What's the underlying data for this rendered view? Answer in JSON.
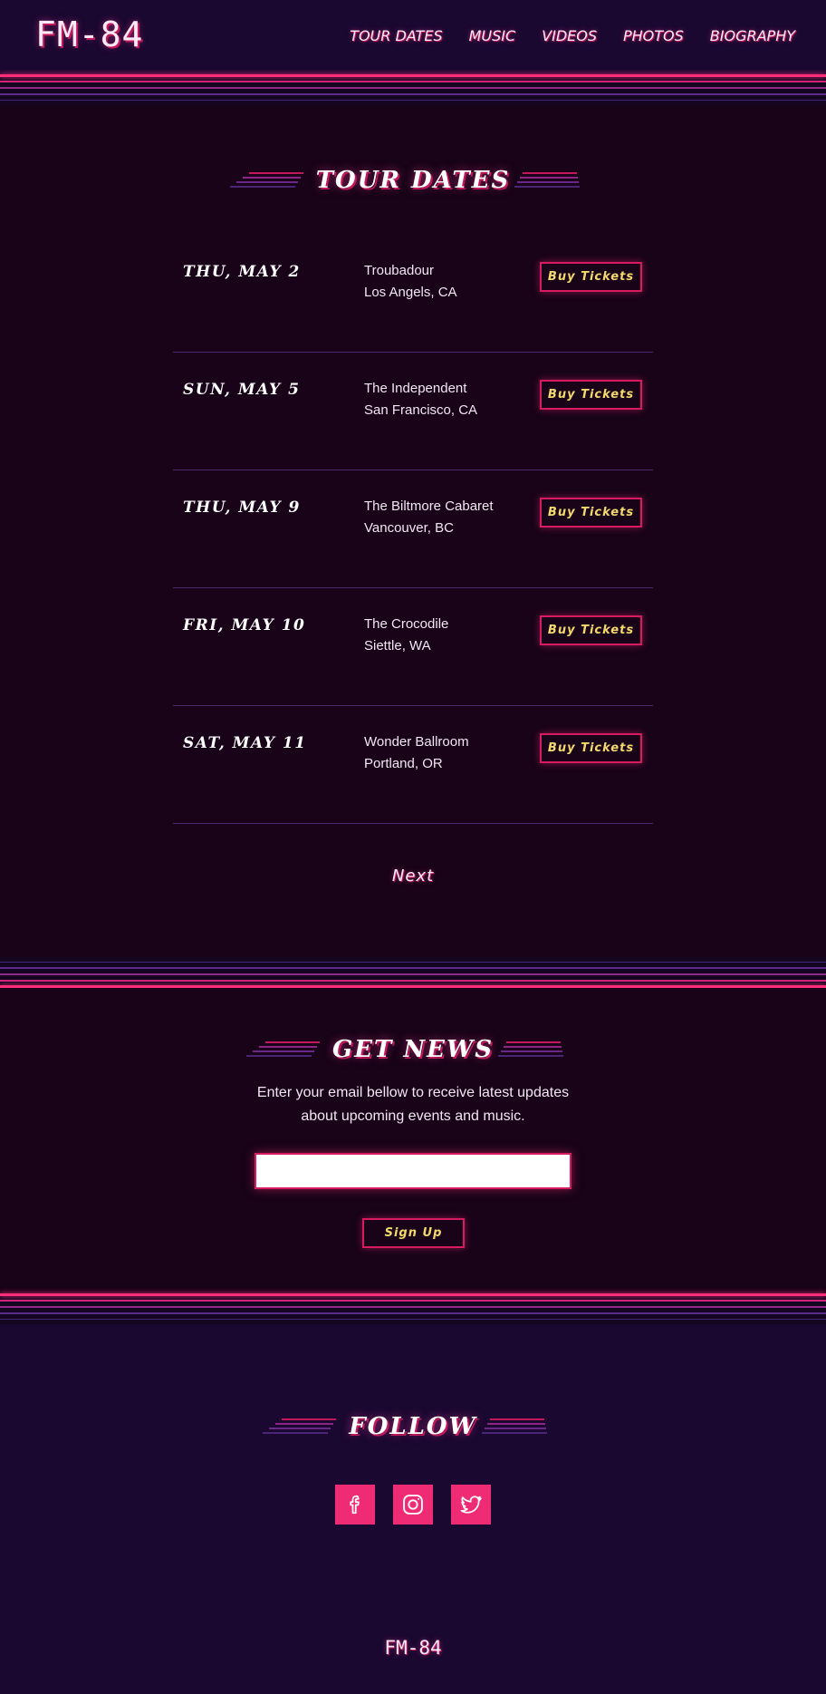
{
  "header": {
    "logo": "FM-84",
    "nav": [
      "TOUR DATES",
      "MUSIC",
      "VIDEOS",
      "PHOTOS",
      "BIOGRAPHY"
    ]
  },
  "tour": {
    "title": "TOUR DATES",
    "button_label": "Buy Tickets",
    "events": [
      {
        "date": "THU, MAY 2",
        "venue": "Troubadour",
        "city": "Los Angels, CA"
      },
      {
        "date": "SUN, MAY 5",
        "venue": "The Independent",
        "city": "San Francisco, CA"
      },
      {
        "date": "THU, MAY 9",
        "venue": "The Biltmore Cabaret",
        "city": "Vancouver, BC"
      },
      {
        "date": "FRI, MAY 10",
        "venue": "The Crocodile",
        "city": "Siettle, WA"
      },
      {
        "date": "SAT, MAY 11",
        "venue": "Wonder Ballroom",
        "city": "Portland, OR"
      }
    ],
    "next_label": "Next"
  },
  "news": {
    "title": "GET NEWS",
    "description_line1": "Enter your email bellow to receive latest updates",
    "description_line2": "about upcoming events and music.",
    "email_value": "",
    "signup_label": "Sign Up"
  },
  "follow": {
    "title": "FOLLOW",
    "socials": [
      "facebook-icon",
      "instagram-icon",
      "twitter-icon"
    ]
  },
  "footer": {
    "logo": "FM-84"
  },
  "colors": {
    "background": "#140621",
    "accent_pink": "#ee2b74",
    "button_text_yellow": "#f3d96c",
    "neon_line": "#ff2d7a"
  }
}
